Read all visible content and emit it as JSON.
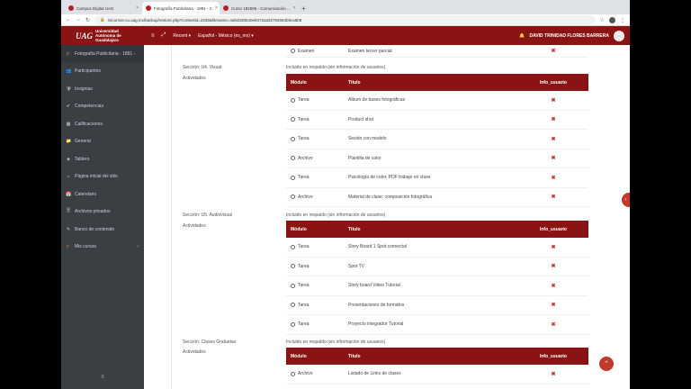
{
  "browser": {
    "tabs": [
      {
        "title": "Campus Digital UAG"
      },
      {
        "title": "Fotografía Publicitaria - 1891 - C"
      },
      {
        "title": "Curso 182595 - Comunicación ..."
      }
    ],
    "new_tab": "+",
    "url": "micursos-cu.uag.mx/backup/restore.php?contextid=2338&filename=4ded330b40eb072aa32794594b9ca5b8"
  },
  "header": {
    "logo_mark": "UAG",
    "logo_text": [
      "Universidad",
      "Autónoma de",
      "Guadalajara"
    ],
    "menu_icon": "≡",
    "expand_icon": "⤢",
    "recent": "Recent ▾",
    "language": "Español - México (es_mx) ▾",
    "user_name": "DAVID TRINIDAD FLORES BARRERA"
  },
  "sidebar": {
    "items": [
      {
        "label": "Fotografía Publicitaria - 1891 -",
        "icon": "🎓"
      },
      {
        "label": "Participantes",
        "icon": "👥"
      },
      {
        "label": "Insignias",
        "icon": "🛡"
      },
      {
        "label": "Competencias",
        "icon": "✔"
      },
      {
        "label": "Calificaciones",
        "icon": "▦"
      },
      {
        "label": "General",
        "icon": "📁"
      },
      {
        "label": "Tablero",
        "icon": "◈"
      },
      {
        "label": "Página inicial del sitio",
        "icon": "⌂"
      },
      {
        "label": "Calendario",
        "icon": "📅"
      },
      {
        "label": "Archivos privados",
        "icon": "🗎"
      },
      {
        "label": "Banco de contenido",
        "icon": "✎"
      },
      {
        "label": "Mis cursos",
        "icon": "🎓",
        "chevron": "›"
      }
    ],
    "bottom_icon": "≡"
  },
  "top_row": {
    "module": "Examen",
    "title": "Examen tercer parcial",
    "info": "✖"
  },
  "sections": [
    {
      "title": "Sección: U4. Visual",
      "subtitle": "Actividades",
      "note": "Incluido en respaldo (sin información de usuarios)",
      "headers": [
        "Módulo",
        "Título",
        "Info_usuario"
      ],
      "rows": [
        {
          "module": "Tarea",
          "title": "Album de bases fotográficas",
          "info": "✖"
        },
        {
          "module": "Tarea",
          "title": "Product shot",
          "info": "✖"
        },
        {
          "module": "Tarea",
          "title": "Sesión con modelo",
          "info": "✖"
        },
        {
          "module": "Archivo",
          "title": "Plantilla de color",
          "info": "✖"
        },
        {
          "module": "Tarea",
          "title": "Psicología de color, PDF trabajo en clase",
          "info": "✖"
        },
        {
          "module": "Archivo",
          "title": "Material de clase: composición fotográfica",
          "info": "✖"
        }
      ]
    },
    {
      "title": "Sección: U5. Audiovisual",
      "subtitle": "Actividades",
      "note": "Incluido en respaldo (sin información de usuarios)",
      "headers": [
        "Módulo",
        "Título",
        "Info_usuario"
      ],
      "rows": [
        {
          "module": "Tarea",
          "title": "Story Board 1 Spot comercial",
          "info": "✖"
        },
        {
          "module": "Tarea",
          "title": "Spot TV",
          "info": "✖"
        },
        {
          "module": "Tarea",
          "title": "Story board Video Tutorial",
          "info": "✖"
        },
        {
          "module": "Tarea",
          "title": "Presentaciones de formatos",
          "info": "✖"
        },
        {
          "module": "Tarea",
          "title": "Proyecto integrador Tutorial",
          "info": "✖"
        }
      ]
    },
    {
      "title": "Sección: Clases Grabadas",
      "subtitle": "Actividades",
      "note": "Incluido en respaldo (sin información de usuarios)",
      "headers": [
        "Módulo",
        "Título",
        "Info_usuario"
      ],
      "rows": [
        {
          "module": "Archivo",
          "title": "Listado de Links de clases",
          "info": "✖"
        }
      ]
    }
  ],
  "fab_icon": "⌃",
  "side_tab_icon": "‹",
  "colors": {
    "brand": "#8a1313",
    "accent": "#c0392b",
    "sidebar": "#3a3f44"
  }
}
